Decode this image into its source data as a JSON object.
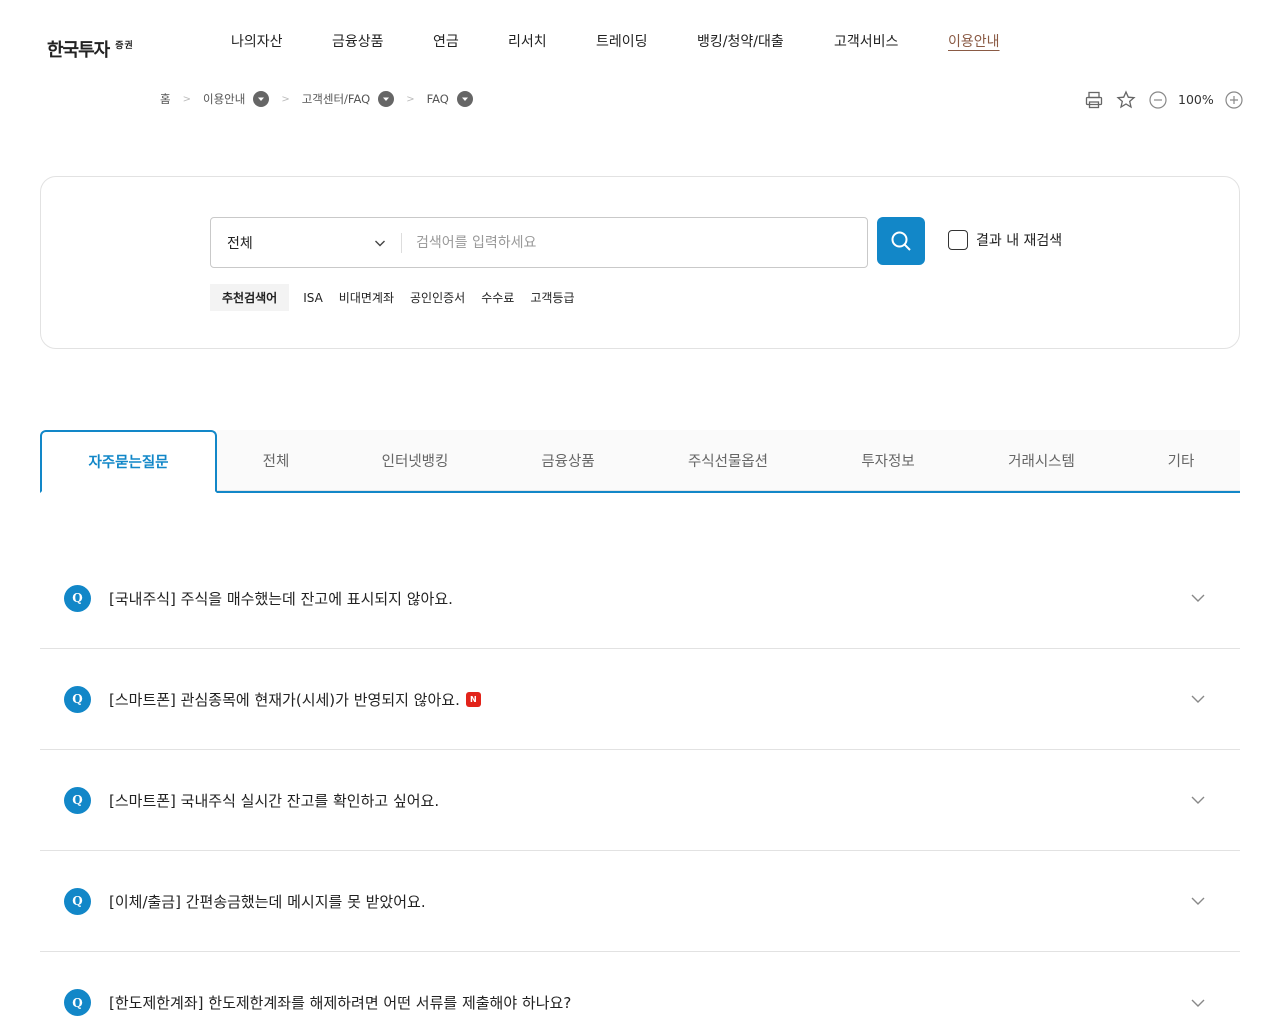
{
  "header": {
    "logo_main": "한국투자",
    "logo_sub": "증권",
    "nav": [
      {
        "label": "나의자산"
      },
      {
        "label": "금융상품"
      },
      {
        "label": "연금"
      },
      {
        "label": "리서치"
      },
      {
        "label": "트레이딩"
      },
      {
        "label": "뱅킹/청약/대출"
      },
      {
        "label": "고객서비스"
      },
      {
        "label": "이용안내",
        "active": true
      }
    ]
  },
  "breadcrumb": {
    "home": "홈",
    "items": [
      "이용안내",
      "고객센터/FAQ",
      "FAQ"
    ]
  },
  "tools": {
    "zoom": "100%",
    "icons": [
      "print-icon",
      "star-icon",
      "zoom-out-icon",
      "zoom-in-icon"
    ]
  },
  "search": {
    "category": "전체",
    "placeholder": "검색어를 입력하세요",
    "research_label": "결과 내 재검색",
    "keywords_label": "추천검색어",
    "keywords": [
      "ISA",
      "비대면계좌",
      "공인인증서",
      "수수료",
      "고객등급"
    ]
  },
  "tabs": [
    {
      "label": "자주묻는질문",
      "active": true
    },
    {
      "label": "전체"
    },
    {
      "label": "인터넷뱅킹"
    },
    {
      "label": "금융상품"
    },
    {
      "label": "주식선물옵션"
    },
    {
      "label": "투자정보"
    },
    {
      "label": "거래시스템"
    },
    {
      "label": "기타"
    }
  ],
  "faq": {
    "badge": "Q",
    "new_badge": "N",
    "items": [
      {
        "question": "[국내주식] 주식을 매수했는데 잔고에 표시되지 않아요.",
        "is_new": false
      },
      {
        "question": "[스마트폰] 관심종목에 현재가(시세)가 반영되지 않아요.",
        "is_new": true
      },
      {
        "question": "[스마트폰] 국내주식 실시간 잔고를 확인하고 싶어요.",
        "is_new": false
      },
      {
        "question": "[이체/출금] 간편송금했는데 메시지를 못 받았어요.",
        "is_new": false
      },
      {
        "question": "[한도제한계좌] 한도제한계좌를 해제하려면 어떤 서류를 제출해야 하나요?",
        "is_new": false
      }
    ]
  },
  "colors": {
    "accent": "#1287c8",
    "active_nav": "#8a5a44",
    "new_badge": "#e2231a"
  }
}
